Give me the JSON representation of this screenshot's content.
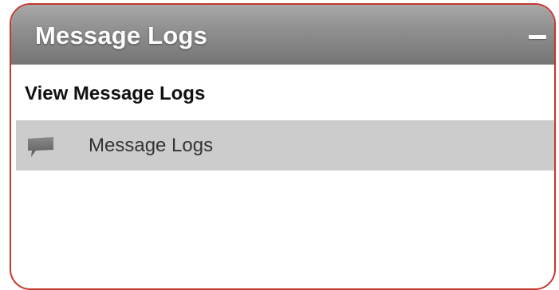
{
  "panel": {
    "title": "Message Logs",
    "collapse_icon": "minus-icon",
    "accent_border": "#c3382f",
    "header_gradient": [
      "#a8a8a8",
      "#767676"
    ]
  },
  "section": {
    "heading": "View Message Logs"
  },
  "menu": {
    "items": [
      {
        "label": "Message Logs",
        "icon": "speech-bubble-icon",
        "highlighted": true
      }
    ]
  }
}
